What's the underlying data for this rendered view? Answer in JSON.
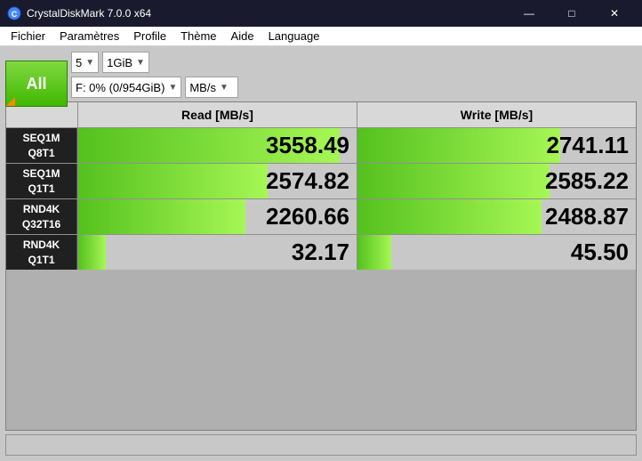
{
  "titlebar": {
    "icon": "crystaldiskmark",
    "title": "CrystalDiskMark 7.0.0 x64",
    "minimize": "—",
    "maximize": "□",
    "close": "✕"
  },
  "menubar": {
    "items": [
      "Fichier",
      "Paramètres",
      "Profile",
      "Thème",
      "Aide",
      "Language"
    ]
  },
  "controls": {
    "all_label": "All",
    "runs": "5",
    "size": "1GiB",
    "drive": "F: 0% (0/954GiB)",
    "units": "MB/s"
  },
  "table": {
    "header_read": "Read [MB/s]",
    "header_write": "Write [MB/s]",
    "rows": [
      {
        "label_line1": "SEQ1M",
        "label_line2": "Q8T1",
        "read": "3558.49",
        "write": "2741.11",
        "read_pct": 94,
        "write_pct": 73
      },
      {
        "label_line1": "SEQ1M",
        "label_line2": "Q1T1",
        "read": "2574.82",
        "write": "2585.22",
        "read_pct": 68,
        "write_pct": 69
      },
      {
        "label_line1": "RND4K",
        "label_line2": "Q32T16",
        "read": "2260.66",
        "write": "2488.87",
        "read_pct": 60,
        "write_pct": 66
      },
      {
        "label_line1": "RND4K",
        "label_line2": "Q1T1",
        "read": "32.17",
        "write": "45.50",
        "read_pct": 10,
        "write_pct": 12
      }
    ]
  }
}
